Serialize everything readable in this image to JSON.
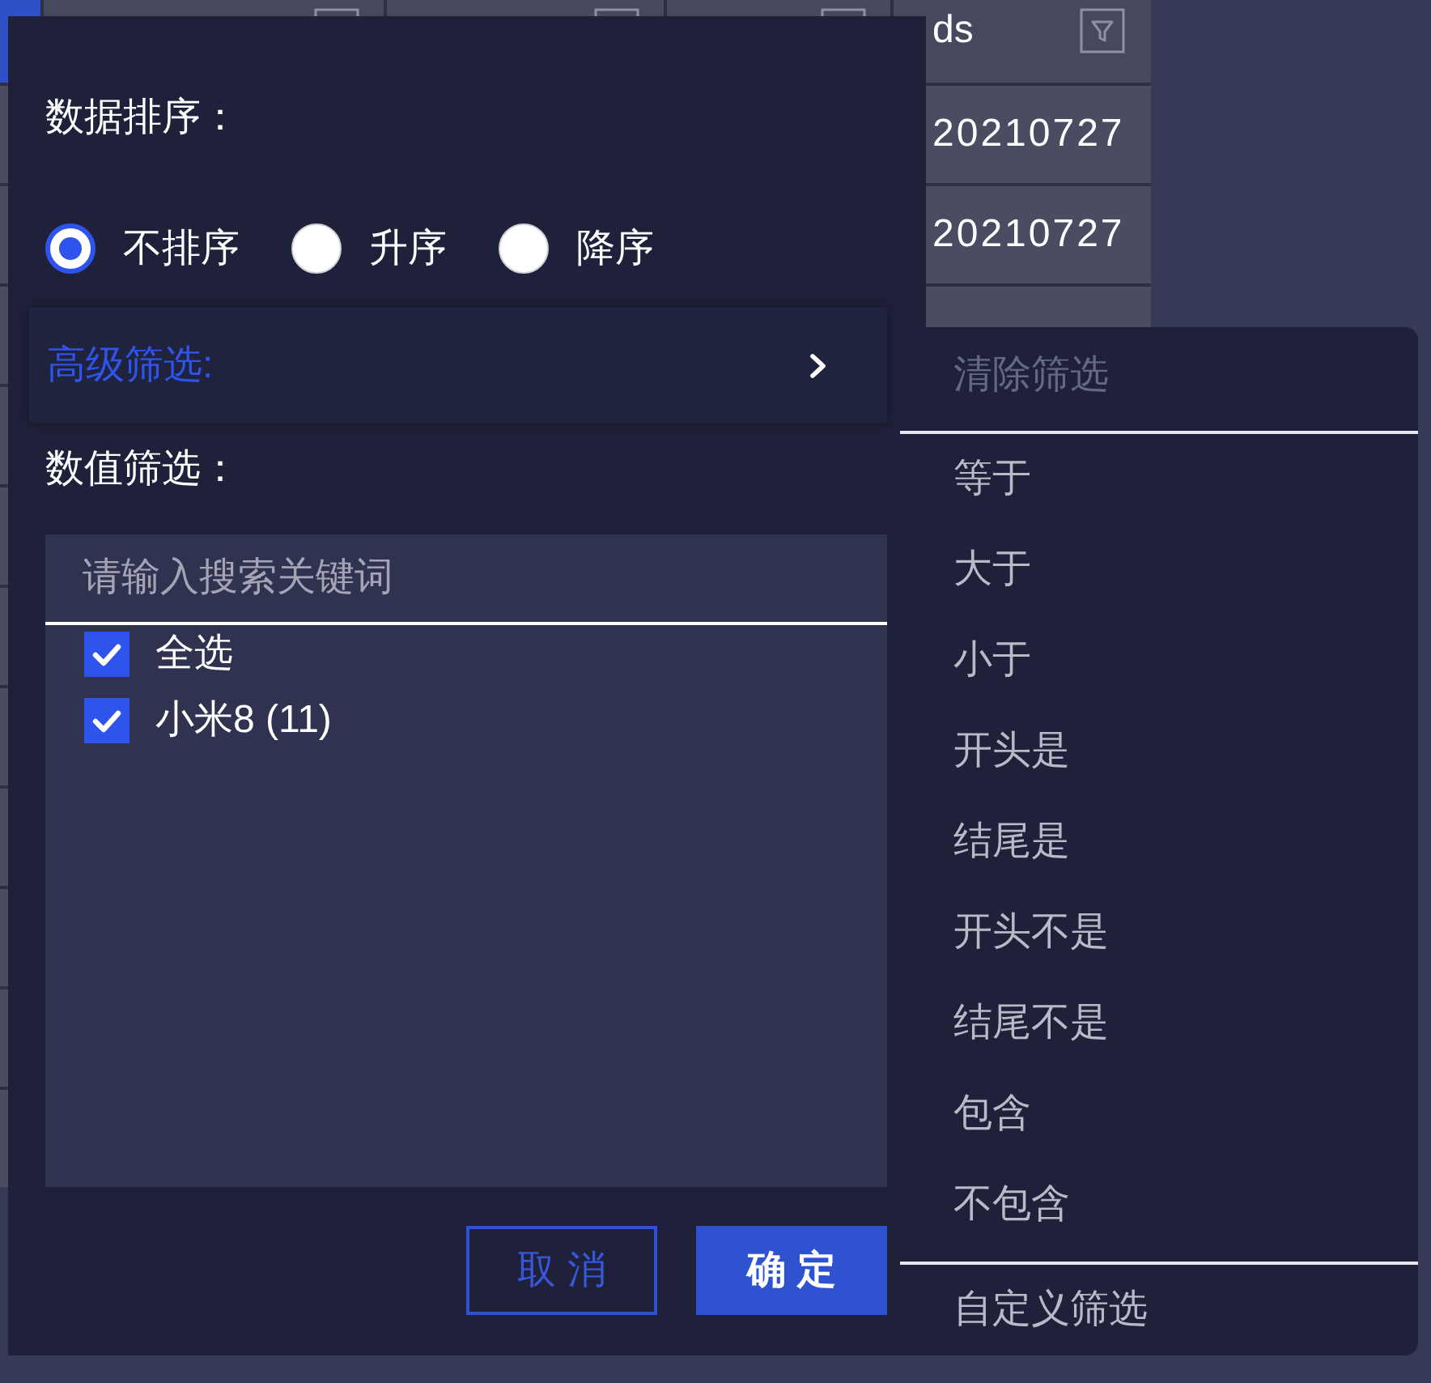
{
  "table": {
    "columns": [
      {
        "selected": true
      },
      {
        "selected": false
      },
      {
        "selected": false
      },
      {
        "selected": false
      },
      {
        "label": "ds",
        "selected": false
      }
    ],
    "rows": [
      {
        "ds": "20210727"
      },
      {
        "ds": "20210727"
      }
    ]
  },
  "filter_popup": {
    "sort": {
      "label": "数据排序：",
      "options": [
        {
          "label": "不排序",
          "selected": true
        },
        {
          "label": "升序",
          "selected": false
        },
        {
          "label": "降序",
          "selected": false
        }
      ]
    },
    "advanced_filter": {
      "label": "高级筛选:",
      "expanded": true
    },
    "value_filter": {
      "label": "数值筛选：",
      "search": {
        "placeholder": "请输入搜索关键词"
      },
      "items": [
        {
          "label": "全选",
          "checked": true
        },
        {
          "label": "小米8 (11)",
          "checked": true
        }
      ]
    },
    "buttons": [
      {
        "label": "取 消",
        "kind": "secondary"
      },
      {
        "label": "确 定",
        "kind": "primary"
      }
    ]
  },
  "advanced_filter_menu": {
    "sections": [
      {
        "items": [
          {
            "label": "清除筛选",
            "disabled": true
          }
        ]
      },
      {
        "items": [
          {
            "label": "等于",
            "disabled": false
          },
          {
            "label": "大于",
            "disabled": false
          },
          {
            "label": "小于",
            "disabled": false
          },
          {
            "label": "开头是",
            "disabled": false
          },
          {
            "label": "结尾是",
            "disabled": false
          },
          {
            "label": "开头不是",
            "disabled": false
          },
          {
            "label": "结尾不是",
            "disabled": false
          },
          {
            "label": "包含",
            "disabled": false
          },
          {
            "label": "不包含",
            "disabled": false
          }
        ]
      },
      {
        "items": [
          {
            "label": "自定义筛选",
            "disabled": false
          }
        ]
      }
    ]
  }
}
